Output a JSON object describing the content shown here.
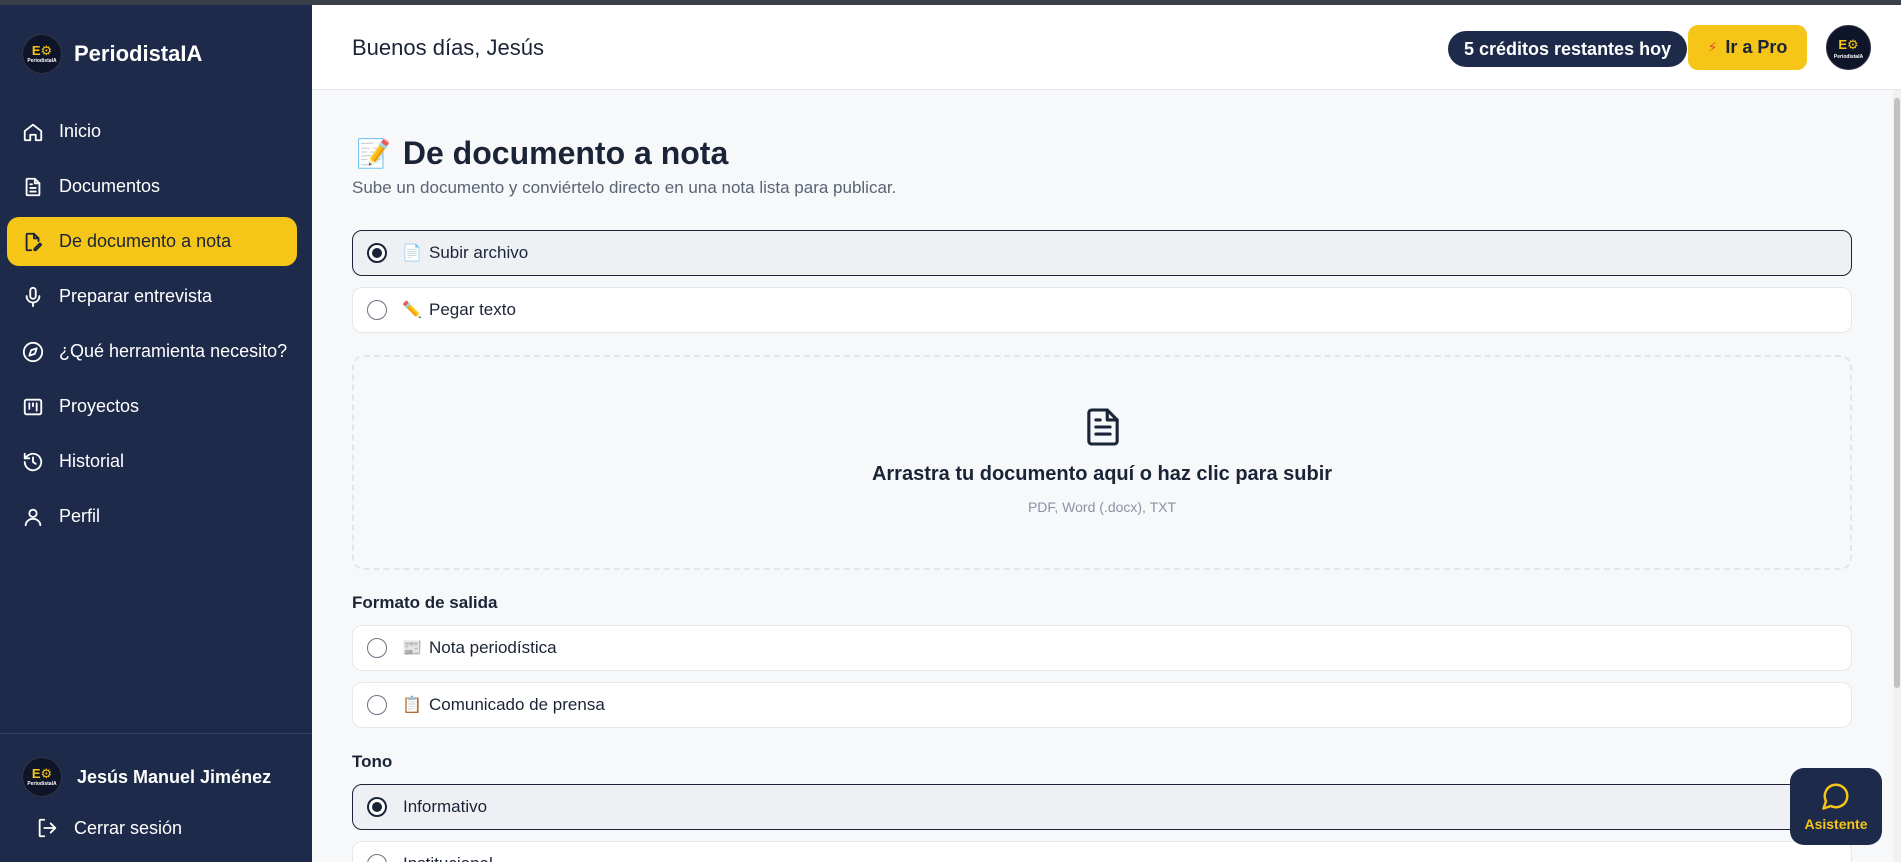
{
  "app": {
    "name": "PeriodistaIA",
    "logo_text": "PeriodistaIA"
  },
  "sidebar": {
    "items": [
      {
        "label": "Inicio",
        "icon": "home-icon"
      },
      {
        "label": "Documentos",
        "icon": "document-icon"
      },
      {
        "label": "De documento a nota",
        "icon": "file-edit-icon",
        "active": true
      },
      {
        "label": "Preparar entrevista",
        "icon": "microphone-icon"
      },
      {
        "label": "¿Qué herramienta necesito?",
        "icon": "compass-icon"
      },
      {
        "label": "Proyectos",
        "icon": "kanban-icon"
      },
      {
        "label": "Historial",
        "icon": "history-icon"
      },
      {
        "label": "Perfil",
        "icon": "user-icon"
      }
    ],
    "user_name": "Jesús Manuel Jiménez",
    "logout_label": "Cerrar sesión"
  },
  "header": {
    "greeting": "Buenos días, Jesús",
    "credits": "5 créditos restantes hoy",
    "pro_label": "Ir a Pro"
  },
  "page": {
    "title_emoji": "📝",
    "title": "De documento a nota",
    "subtitle": "Sube un documento y conviértelo directo en una nota lista para publicar.",
    "input_mode": [
      {
        "emoji": "📄",
        "label": "Subir archivo",
        "selected": true
      },
      {
        "emoji": "✏️",
        "label": "Pegar texto",
        "selected": false
      }
    ],
    "dropzone": {
      "title": "Arrastra tu documento aquí o haz clic para subir",
      "formats": "PDF, Word (.docx), TXT"
    },
    "format_label": "Formato de salida",
    "formats": [
      {
        "emoji": "📰",
        "label": "Nota periodística",
        "selected": false
      },
      {
        "emoji": "📋",
        "label": "Comunicado de prensa",
        "selected": false
      }
    ],
    "tone_label": "Tono",
    "tones": [
      {
        "label": "Informativo",
        "selected": true
      },
      {
        "label": "Institucional",
        "selected": false
      }
    ]
  },
  "assistant": {
    "label": "Asistente"
  },
  "colors": {
    "sidebar": "#1e2a4a",
    "accent": "#f5c518",
    "text": "#1b2437"
  }
}
